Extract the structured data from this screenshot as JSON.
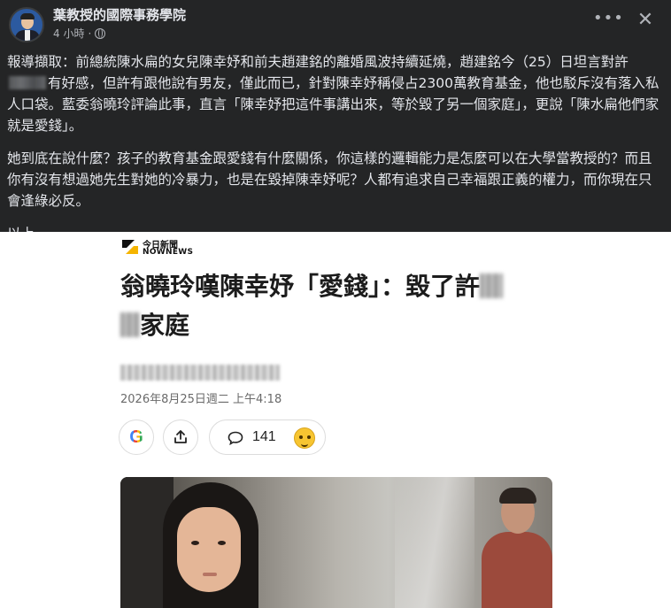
{
  "post": {
    "page_name": "葉教授的國際事務學院",
    "time": "4 小時",
    "visibility_icon": "globe-icon",
    "more_icon": "more-options-icon",
    "close_icon": "close-icon",
    "paragraph1_a": "報導擷取：前總統陳水扁的女兒陳幸妤和前夫趙建銘的離婚風波持續延燒，趙建銘今（25）日坦言對許",
    "paragraph1_b": "有好感，但許有跟他說有男友，僅此而已，針對陳幸妤稱侵占2300萬教育基金，他也駁斥沒有落入私人口袋。藍委翁曉玲評論此事，直言「陳幸妤把這件事講出來，等於毀了另一個家庭」，更說「陳水扁他們家就是愛錢」。",
    "paragraph2": "她到底在說什麼？孩子的教育基金跟愛錢有什麼關係，你這樣的邏輯能力是怎麼可以在大學當教授的？而且你有沒有想過她先生對她的冷暴力，也是在毀掉陳幸妤呢？人都有追求自己幸福跟正義的權力，而你現在只會逢綠必反。",
    "paragraph3": "以上。"
  },
  "article": {
    "source_cn": "今日新聞",
    "source_en": "NOWNEWS",
    "headline_a": "翁曉玲嘆陳幸妤「愛錢」：毀了許",
    "headline_b": "家庭",
    "date": "2026年8月25日週二 上午4:18",
    "google_label": "G",
    "comment_count": "141",
    "reaction_icon": "thinking-face-icon"
  }
}
